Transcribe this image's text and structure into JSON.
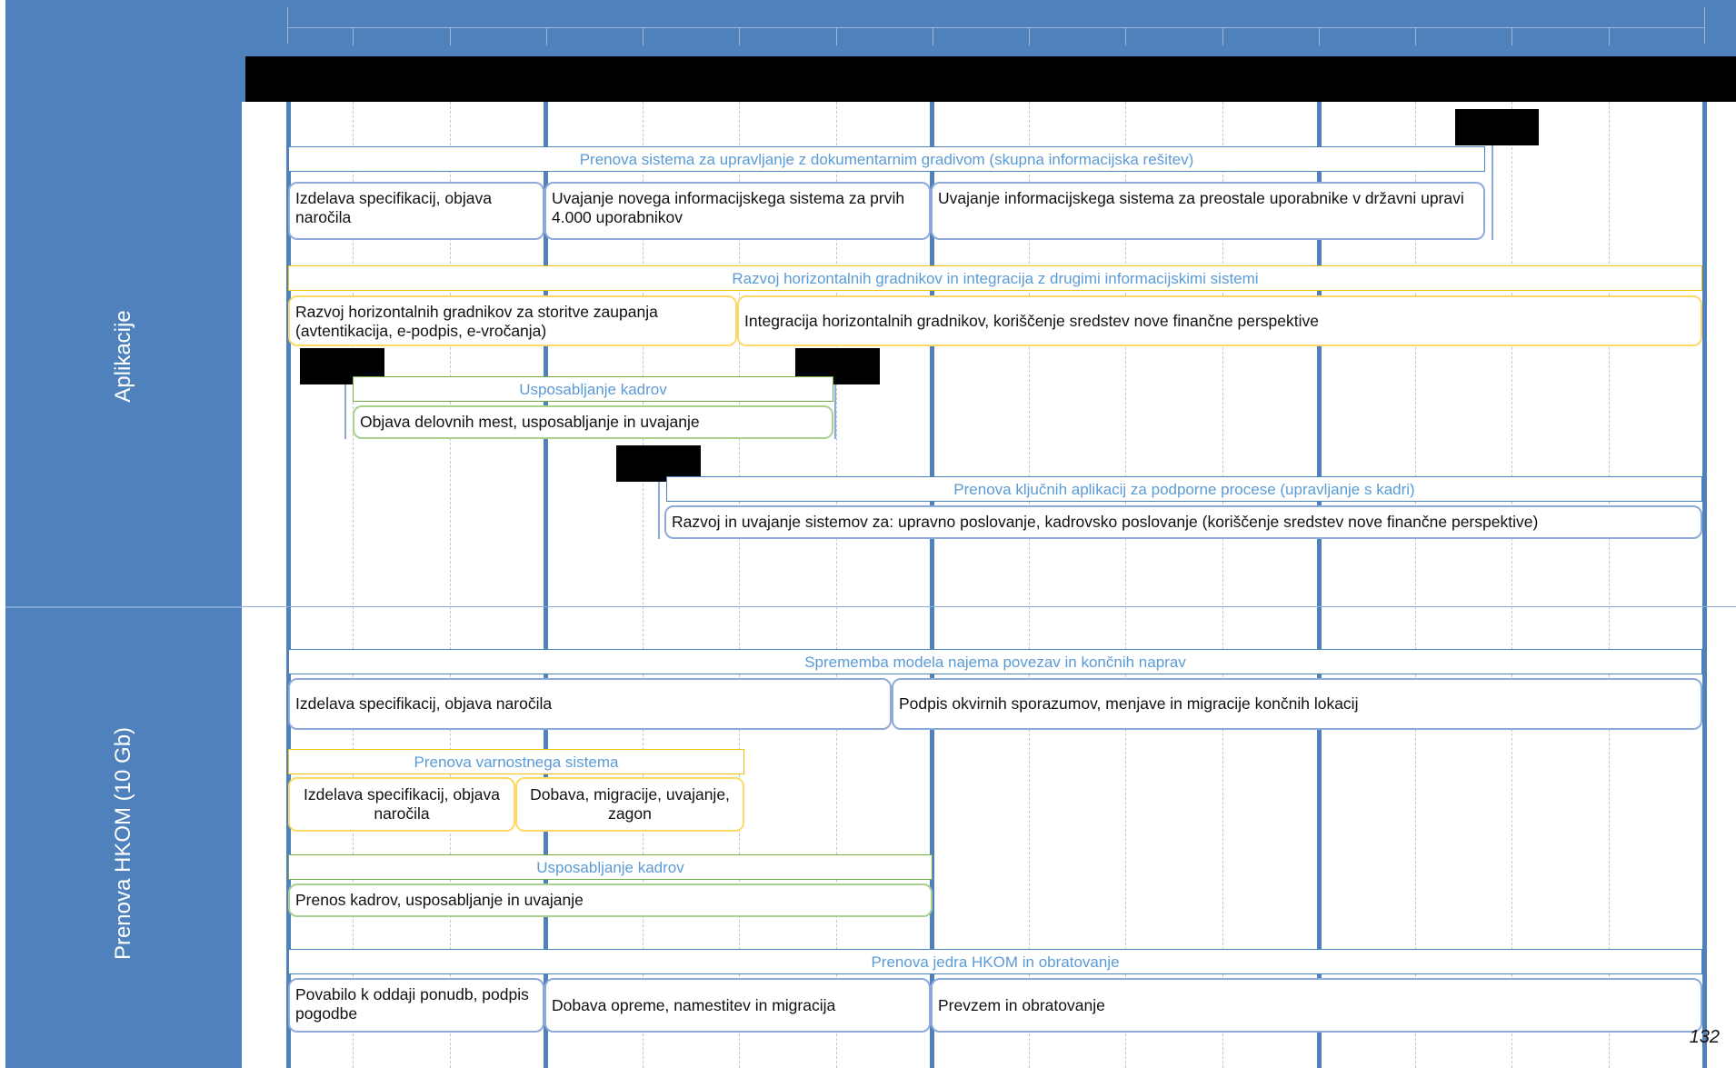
{
  "lanes": [
    {
      "label": "Aplikacije"
    },
    {
      "label": "Prenova HKOM (10 Gb)"
    }
  ],
  "groups": {
    "g1": {
      "title": "Prenova sistema za upravljanje z dokumentarnim gradivom (skupna informacijska rešitev)",
      "tasks": [
        "Izdelava specifikacij, objava naročila",
        "Uvajanje novega informacijskega sistema za prvih 4.000 uporabnikov",
        "Uvajanje informacijskega sistema za preostale uporabnike v državni upravi"
      ]
    },
    "g2": {
      "title": "Razvoj horizontalnih gradnikov in integracija z drugimi informacijskimi sistemi",
      "tasks": [
        "Razvoj horizontalnih gradnikov za storitve zaupanja (avtentikacija, e-podpis, e-vročanja)",
        "Integracija horizontalnih gradnikov, koriščenje sredstev nove finančne perspektive"
      ]
    },
    "g3": {
      "title": "Usposabljanje kadrov",
      "tasks": [
        "Objava delovnih mest, usposabljanje in uvajanje"
      ]
    },
    "g4": {
      "title": "Prenova ključnih aplikacij za podporne procese (upravljanje s kadri)",
      "tasks": [
        "Razvoj in uvajanje sistemov za: upravno poslovanje, kadrovsko poslovanje (koriščenje sredstev nove finančne perspektive)"
      ]
    },
    "g5": {
      "title": "Sprememba modela najema povezav in končnih naprav",
      "tasks": [
        "Izdelava specifikacij, objava naročila",
        "Podpis okvirnih sporazumov, menjave in migracije končnih lokacij"
      ]
    },
    "g6": {
      "title": "Prenova varnostnega sistema",
      "tasks": [
        "Izdelava specifikacij, objava naročila",
        "Dobava, migracije, uvajanje, zagon"
      ]
    },
    "g7": {
      "title": "Usposabljanje kadrov",
      "tasks": [
        "Prenos kadrov, usposabljanje in uvajanje"
      ]
    },
    "g8": {
      "title": "Prenova jedra HKOM in obratovanje",
      "tasks": [
        "Povabilo k oddaji ponudb, podpis pogodbe",
        "Dobava opreme, namestitev in migracija",
        "Prevzem in obratovanje"
      ]
    }
  },
  "page_number": "132",
  "colors": {
    "band": "#4f81bd",
    "blue": "#4f81bd",
    "yellow": "#f2c000",
    "green": "#70ad47",
    "header_text": "#5b9bd5"
  }
}
